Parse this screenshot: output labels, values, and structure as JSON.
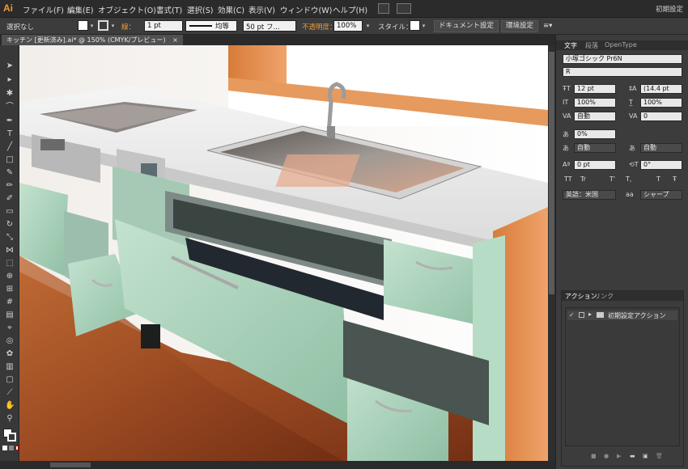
{
  "app": {
    "logo": "Ai",
    "workspace": "初期設定"
  },
  "menu": [
    "ファイル(F)",
    "編集(E)",
    "オブジェクト(O)",
    "書式(T)",
    "選択(S)",
    "効果(C)",
    "表示(V)",
    "ウィンドウ(W)",
    "ヘルプ(H)"
  ],
  "control": {
    "selection": "選択なし",
    "stroke_label": "線：",
    "stroke_weight": "1 pt",
    "stroke_style": "均等",
    "brush": "50 pt フ...",
    "opacity_label": "不透明度：",
    "opacity": "100%",
    "style_label": "スタイル：",
    "document_setup": "ドキュメント設定",
    "preferences": "環境設定"
  },
  "document": {
    "tab": "キッチン [更新済み].ai* @ 150% (CMYK/プレビュー)",
    "close": "×"
  },
  "character_panel": {
    "tabs": [
      "文字",
      "段落",
      "OpenType"
    ],
    "font_family": "小塚ゴシック Pr6N",
    "font_style": "R",
    "font_size": "12 pt",
    "leading": "(14.4 pt",
    "vertical_scale": "100%",
    "horizontal_scale": "100%",
    "kerning": "自動",
    "tracking": "0",
    "tsume": "0%",
    "aki_left": "自動",
    "aki_right": "自動",
    "baseline_shift": "0 pt",
    "rotation": "0°",
    "language": "英語：米国",
    "anti_alias": "シャープ",
    "aa_label": "aa",
    "tt_icons": [
      "TT",
      "Tr",
      "T'",
      "T,",
      "T",
      "Ŧ"
    ]
  },
  "actions_panel": {
    "tabs": [
      "アクション",
      "リンク"
    ],
    "set_name": "初期設定アクション",
    "checkmark": "✓"
  },
  "colors": {
    "accent_orange": "#f29b31",
    "cabinet_green": "#a9d1bb",
    "counter_white": "#eeeeee",
    "floor_wood": "#9b4a22"
  }
}
